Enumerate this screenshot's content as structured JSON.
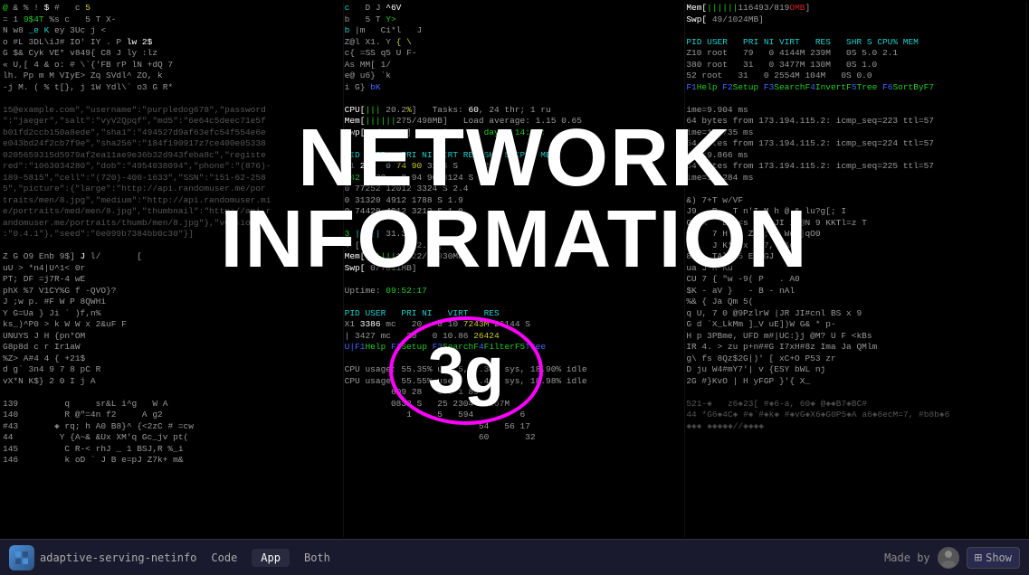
{
  "title": {
    "line1": "NETWORK",
    "line2": "INFORMATION"
  },
  "circle": {
    "text": "3g"
  },
  "taskbar": {
    "app_name": "adaptive-serving-netinfo",
    "tabs": [
      {
        "id": "code",
        "label": "Code",
        "active": false
      },
      {
        "id": "app",
        "label": "App",
        "active": true
      },
      {
        "id": "both",
        "label": "Both",
        "active": false
      }
    ],
    "made_by": "Made by",
    "show_label": "Show"
  }
}
